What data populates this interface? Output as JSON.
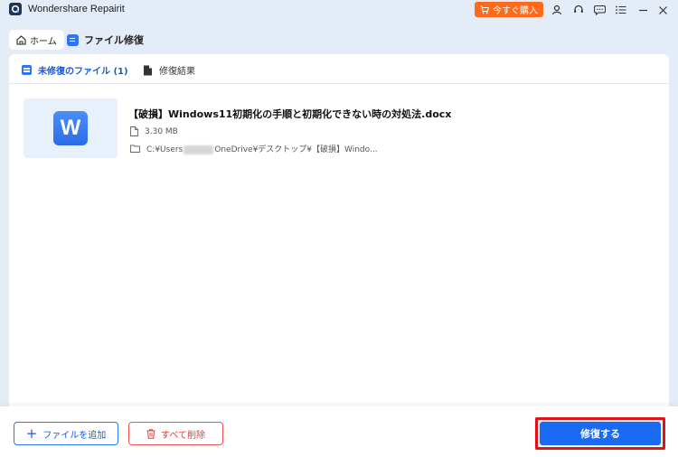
{
  "window": {
    "title": "Wondershare Repairit",
    "buy_label": "今すぐ購入"
  },
  "tabs": {
    "home": "ホーム",
    "file_repair": "ファイル修復"
  },
  "subtabs": {
    "unrepaired": "未修復のファイル (1)",
    "results": "修復結果"
  },
  "file": {
    "name": "【破損】Windows11初期化の手順と初期化できない時の対処法.docx",
    "size": "3.30 MB",
    "path_prefix": "C:¥Users",
    "path_suffix": "OneDrive¥デスクトップ¥【破損】Windo...",
    "icon_letter": "W"
  },
  "footer": {
    "add_label": "ファイルを追加",
    "clear_label": "すべて削除",
    "repair_label": "修復する"
  },
  "colors": {
    "accent": "#1b6af3",
    "buy": "#ff6a1a",
    "danger": "#e03a3a",
    "highlight": "#e0121c"
  }
}
